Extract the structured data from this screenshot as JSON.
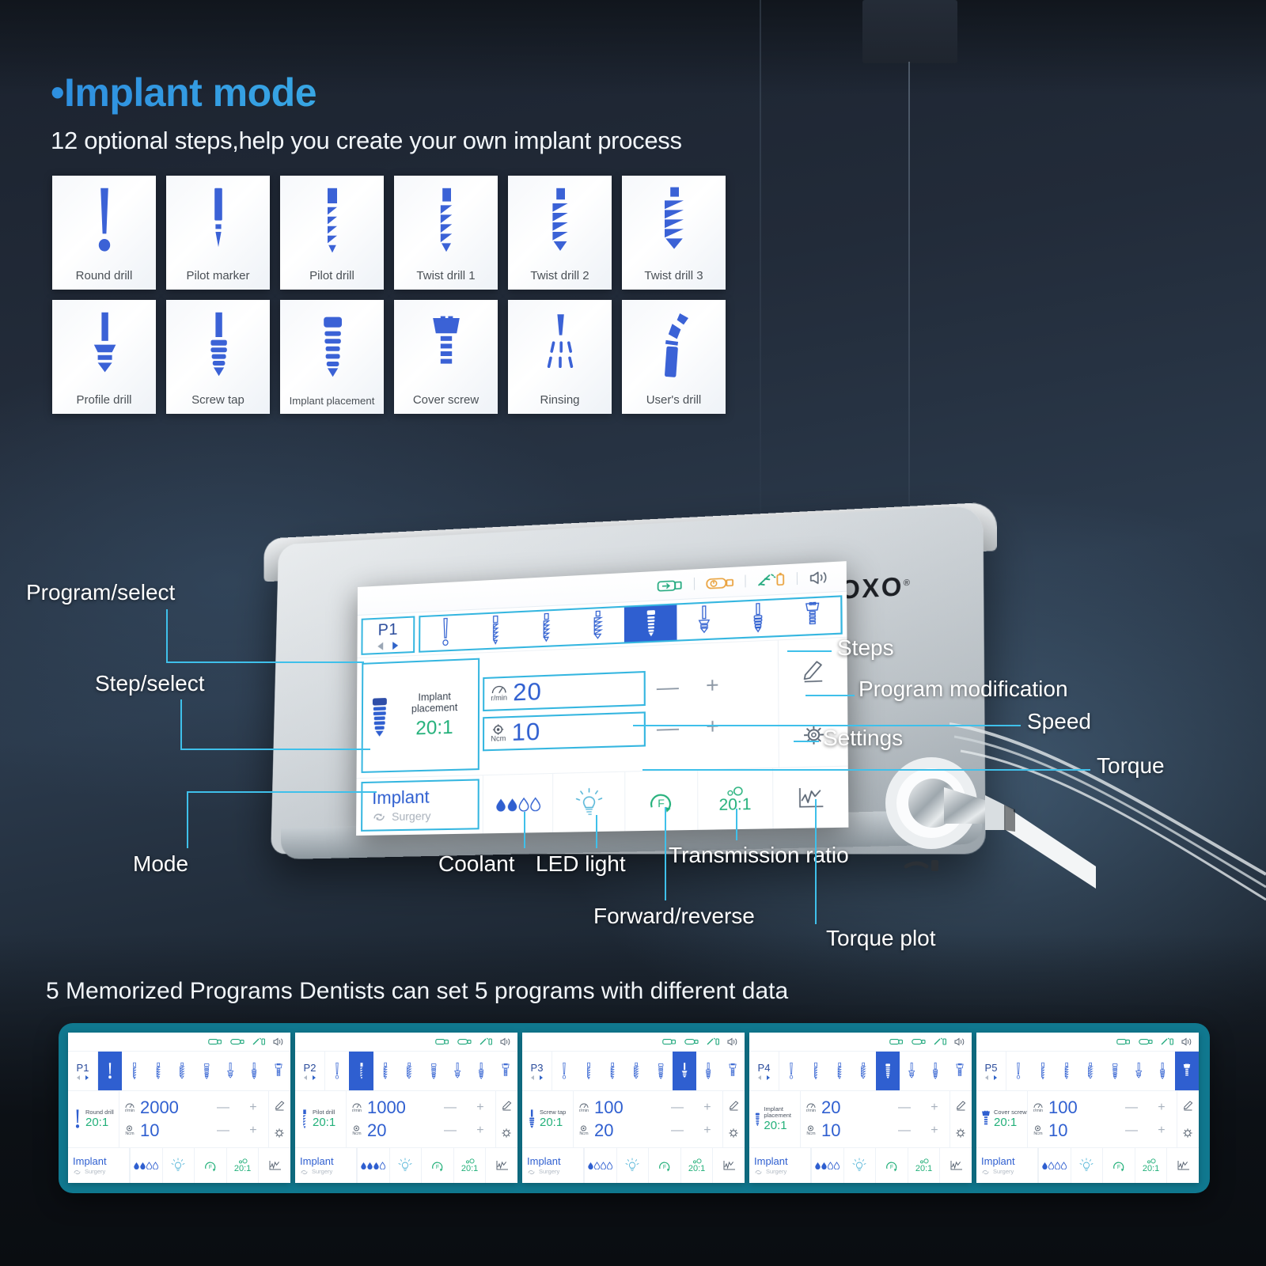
{
  "header": {
    "title": "•Implant mode",
    "subtitle": "12 optional steps,help you create your own implant process"
  },
  "steps_grid": [
    {
      "label": "Round drill",
      "icon": "round-drill-icon"
    },
    {
      "label": "Pilot marker",
      "icon": "pilot-marker-icon"
    },
    {
      "label": "Pilot drill",
      "icon": "pilot-drill-icon"
    },
    {
      "label": "Twist drill 1",
      "icon": "twist-drill-1-icon"
    },
    {
      "label": "Twist drill 2",
      "icon": "twist-drill-2-icon"
    },
    {
      "label": "Twist drill 3",
      "icon": "twist-drill-3-icon"
    },
    {
      "label": "Profile drill",
      "icon": "profile-drill-icon"
    },
    {
      "label": "Screw tap",
      "icon": "screw-tap-icon"
    },
    {
      "label": "Implant placement",
      "icon": "implant-placement-icon"
    },
    {
      "label": "Cover screw",
      "icon": "cover-screw-icon"
    },
    {
      "label": "Rinsing",
      "icon": "rinsing-icon"
    },
    {
      "label": "User's drill",
      "icon": "users-drill-icon"
    }
  ],
  "device": {
    "brand": "COXO",
    "brand_mark": "®"
  },
  "screen": {
    "status_icons": [
      "usb-icon",
      "foot-pedal-icon",
      "handpiece-battery-icon",
      "speaker-icon"
    ],
    "program": {
      "name": "P1",
      "prev": "prev-arrow-icon",
      "next": "next-arrow-icon"
    },
    "steps_active_index": 4,
    "current_step": {
      "name_line1": "Implant",
      "name_line2": "placement",
      "ratio": "20:1",
      "icon": "implant-placement-icon"
    },
    "speed": {
      "value": "20",
      "unit": "r/min",
      "minus": "—",
      "plus": "+",
      "icon": "speed-gauge-icon"
    },
    "torque": {
      "value": "10",
      "unit": "Ncm",
      "minus": "—",
      "plus": "+",
      "icon": "torque-gear-icon"
    },
    "side_buttons": [
      {
        "name": "pencil-icon",
        "label": "Program modification"
      },
      {
        "name": "gear-icon",
        "label": "Settings"
      }
    ],
    "mode": {
      "title": "Implant",
      "sub": "Surgery",
      "icon": "loop-arrows-icon"
    },
    "bottom_buttons": [
      {
        "name": "coolant-icon",
        "label": "Coolant",
        "value": "2 of 4"
      },
      {
        "name": "led-light-icon",
        "label": "LED light",
        "value": ""
      },
      {
        "name": "forward-icon",
        "label": "Forward/reverse",
        "value": "F"
      },
      {
        "name": "ratio-icon",
        "label": "Transmission ratio",
        "value": "20:1"
      },
      {
        "name": "torque-plot-icon",
        "label": "Torque plot",
        "value": ""
      }
    ]
  },
  "callouts": {
    "program_select": "Program/select",
    "step_select": "Step/select",
    "mode": "Mode",
    "steps": "Steps",
    "program_modification": "Program modification",
    "speed": "Speed",
    "settings": "Settings",
    "torque": "Torque",
    "coolant": "Coolant",
    "led_light": "LED light",
    "transmission_ratio": "Transmission ratio",
    "forward_reverse": "Forward/reverse",
    "torque_plot": "Torque plot"
  },
  "memorized": {
    "title": "5 Memorized Programs Dentists can set 5 programs with different data",
    "programs": [
      {
        "name": "P1",
        "step": "Round drill",
        "ratio": "20:1",
        "speed": "2000",
        "torque": "10",
        "active_index": 0,
        "coolant_level": 2,
        "mode_title": "Implant",
        "mode_sub": "Surgery",
        "fwd": "F",
        "ratio_btn": "20:1"
      },
      {
        "name": "P2",
        "step": "Pilot drill",
        "ratio": "20:1",
        "speed": "1000",
        "torque": "20",
        "active_index": 1,
        "coolant_level": 3,
        "mode_title": "Implant",
        "mode_sub": "Surgery",
        "fwd": "F",
        "ratio_btn": "20:1"
      },
      {
        "name": "P3",
        "step": "Screw tap",
        "ratio": "20:1",
        "speed": "100",
        "torque": "20",
        "active_index": 5,
        "coolant_level": 1,
        "mode_title": "Implant",
        "mode_sub": "Surgery",
        "fwd": "F",
        "ratio_btn": "20:1"
      },
      {
        "name": "P4",
        "step": "Implant placement",
        "ratio": "20:1",
        "speed": "20",
        "torque": "10",
        "active_index": 4,
        "coolant_level": 2,
        "mode_title": "Implant",
        "mode_sub": "Surgery",
        "fwd": "F",
        "ratio_btn": "20:1"
      },
      {
        "name": "P5",
        "step": "Cover screw",
        "ratio": "20:1",
        "speed": "100",
        "torque": "10",
        "active_index": 7,
        "coolant_level": 1,
        "mode_title": "Implant",
        "mode_sub": "Surgery",
        "fwd": "F",
        "ratio_btn": "20:1"
      }
    ]
  },
  "colors": {
    "accent_blue": "#3fc0ea",
    "icon_blue": "#3b62d6",
    "value_blue": "#2f5fd0",
    "green": "#23b07a",
    "teal_frame": "#10788f",
    "title_gradient_from": "#2e8fe0",
    "title_gradient_to": "#45c5e8"
  }
}
